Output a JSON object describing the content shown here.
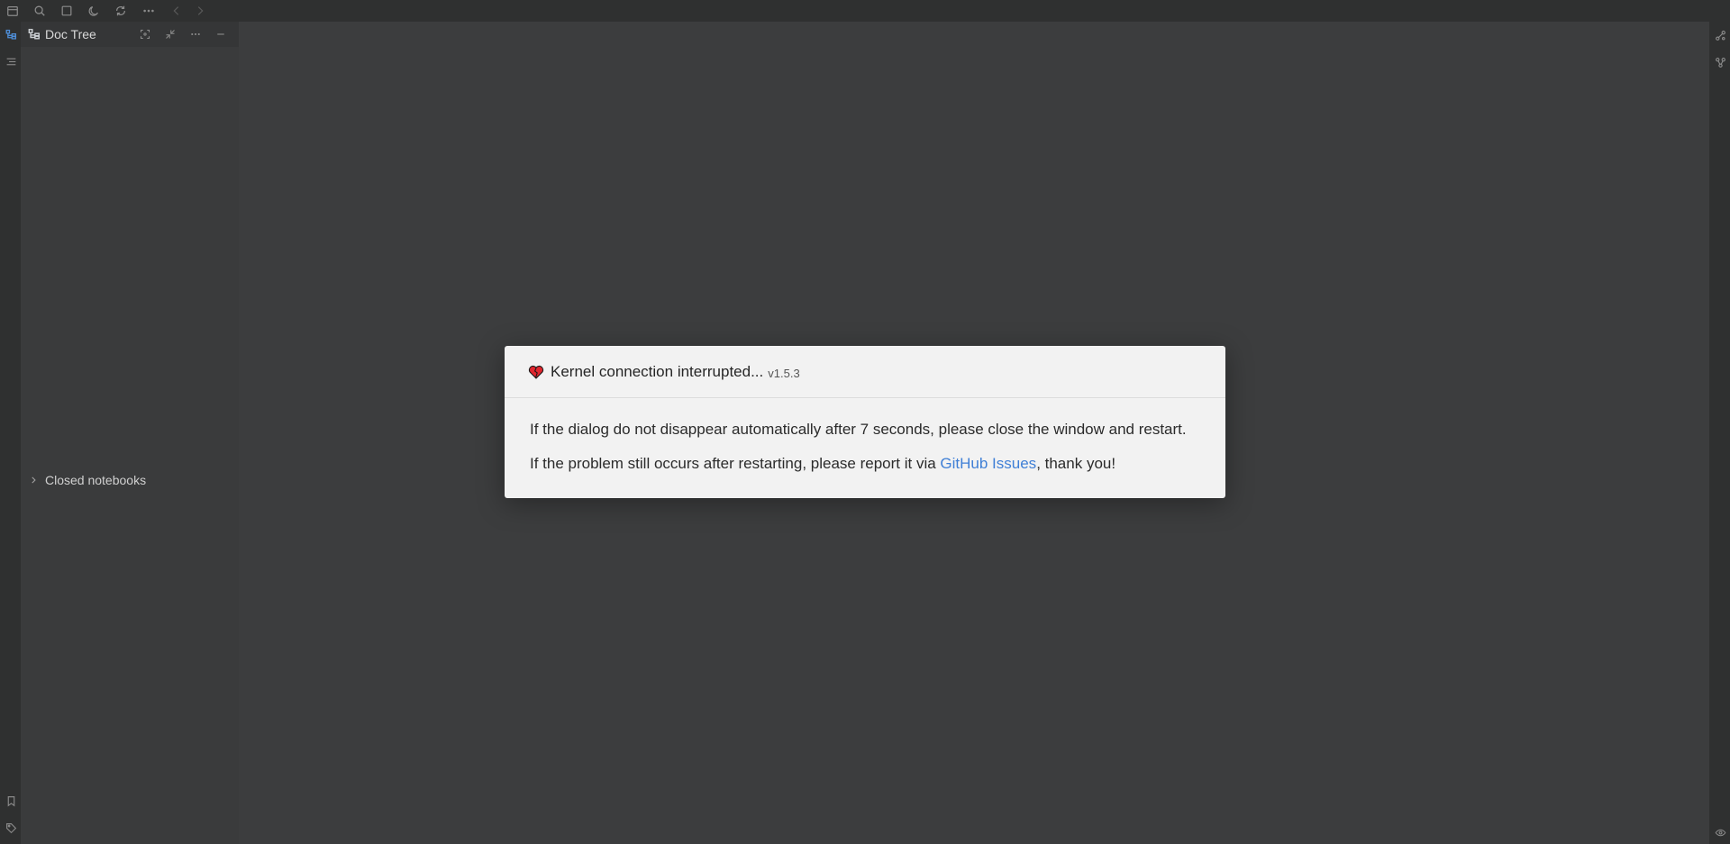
{
  "toolbar": {
    "icons": [
      "calendar-icon",
      "search-icon",
      "layout-icon",
      "moon-icon",
      "sync-icon",
      "more-icon",
      "back-icon",
      "forward-icon"
    ]
  },
  "doc_tree": {
    "title": "Doc Tree",
    "closed_notebooks_label": "Closed notebooks"
  },
  "dialog": {
    "title": "Kernel connection interrupted...",
    "version": "v1.5.3",
    "line1": "If the dialog do not disappear automatically after 7 seconds, please close the window and restart.",
    "line2_prefix": "If the problem still occurs after restarting, please report it via ",
    "line2_link": "GitHub Issues",
    "line2_suffix": ", thank you!"
  },
  "colors": {
    "background": "#3c3d3e",
    "panel": "#3a3b3c",
    "dock": "#2f3030",
    "dialog_bg": "#f2f2f2",
    "link": "#3f7fd6",
    "accent": "#4f8fd9",
    "heart": "#e0262e"
  }
}
